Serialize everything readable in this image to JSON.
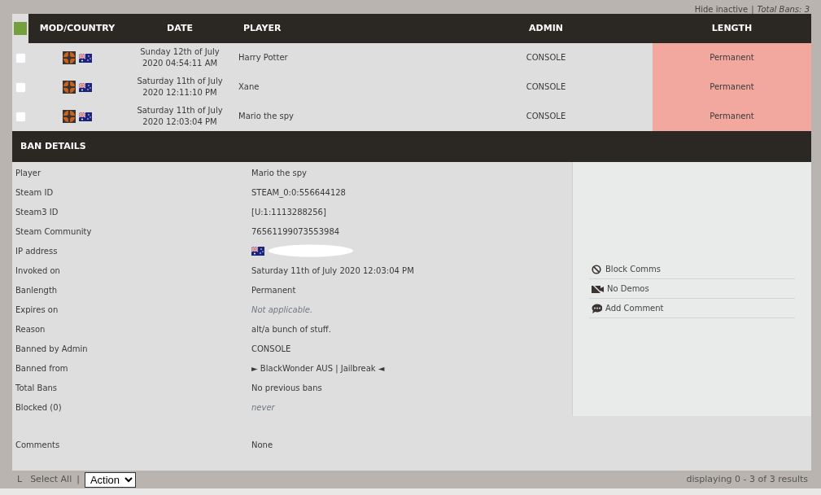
{
  "top_links": {
    "hide_inactive": "Hide inactive",
    "separator": "|",
    "total_bans": "Total Bans: 3"
  },
  "table": {
    "columns": [
      "MOD/COUNTRY",
      "DATE",
      "PLAYER",
      "ADMIN",
      "LENGTH"
    ],
    "rows": [
      {
        "checked": false,
        "date_line1": "Sunday 12th of July",
        "date_line2": "2020 04:54:11 AM",
        "player": "Harry Potter",
        "admin": "CONSOLE",
        "length": "Permanent",
        "color": "#f2a89e"
      },
      {
        "checked": false,
        "date_line1": "Saturday 11th of July",
        "date_line2": "2020 12:11:10 PM",
        "player": "Xane",
        "admin": "CONSOLE",
        "length": "Permanent",
        "color": "#f2a89e"
      },
      {
        "checked": false,
        "date_line1": "Saturday 11th of July",
        "date_line2": "2020 12:03:04 PM",
        "player": "Mario the spy",
        "admin": "CONSOLE",
        "length": "Permanent",
        "color": "#f2a89e"
      }
    ]
  },
  "ban_details": {
    "title": "BAN DETAILS",
    "fields": [
      {
        "label": "Player",
        "value": "Mario the spy",
        "kind": "text"
      },
      {
        "label": "Steam ID",
        "value": "STEAM_0:0:556644128",
        "kind": "text"
      },
      {
        "label": "Steam3 ID",
        "value": "[U:1:1113288256]",
        "kind": "text"
      },
      {
        "label": "Steam Community",
        "value": "76561199073553984",
        "kind": "text"
      },
      {
        "label": "IP address",
        "kind": "ip"
      },
      {
        "label": "Invoked on",
        "value": "Saturday 11th of July 2020 12:03:04 PM",
        "kind": "text"
      },
      {
        "label": "Banlength",
        "value": "Permanent",
        "kind": "text"
      },
      {
        "label": "Expires on",
        "value": "Not applicable.",
        "kind": "muted"
      },
      {
        "label": "Reason",
        "value": "alt/a bunch of stuff.",
        "kind": "text"
      },
      {
        "label": "Banned by Admin",
        "value": "CONSOLE",
        "kind": "text"
      },
      {
        "label": "Banned from",
        "value": "► BlackWonder AUS | Jailbreak ◄",
        "kind": "text"
      },
      {
        "label": "Total Bans",
        "value": "No previous bans",
        "kind": "text"
      },
      {
        "label": "Blocked (0)",
        "value": "never",
        "kind": "muted"
      },
      {
        "label": "Comments",
        "value": "None",
        "kind": "comments"
      }
    ],
    "actions": [
      {
        "label": "Block Comms",
        "kind": "block"
      },
      {
        "label": "No Demos",
        "kind": "nodemo"
      },
      {
        "label": "Add Comment",
        "kind": "comment"
      }
    ]
  },
  "footer": {
    "corner": "L",
    "select_all": "Select All",
    "separator": "|",
    "action": "Action",
    "results": "displaying 0 - 3 of 3 results"
  }
}
